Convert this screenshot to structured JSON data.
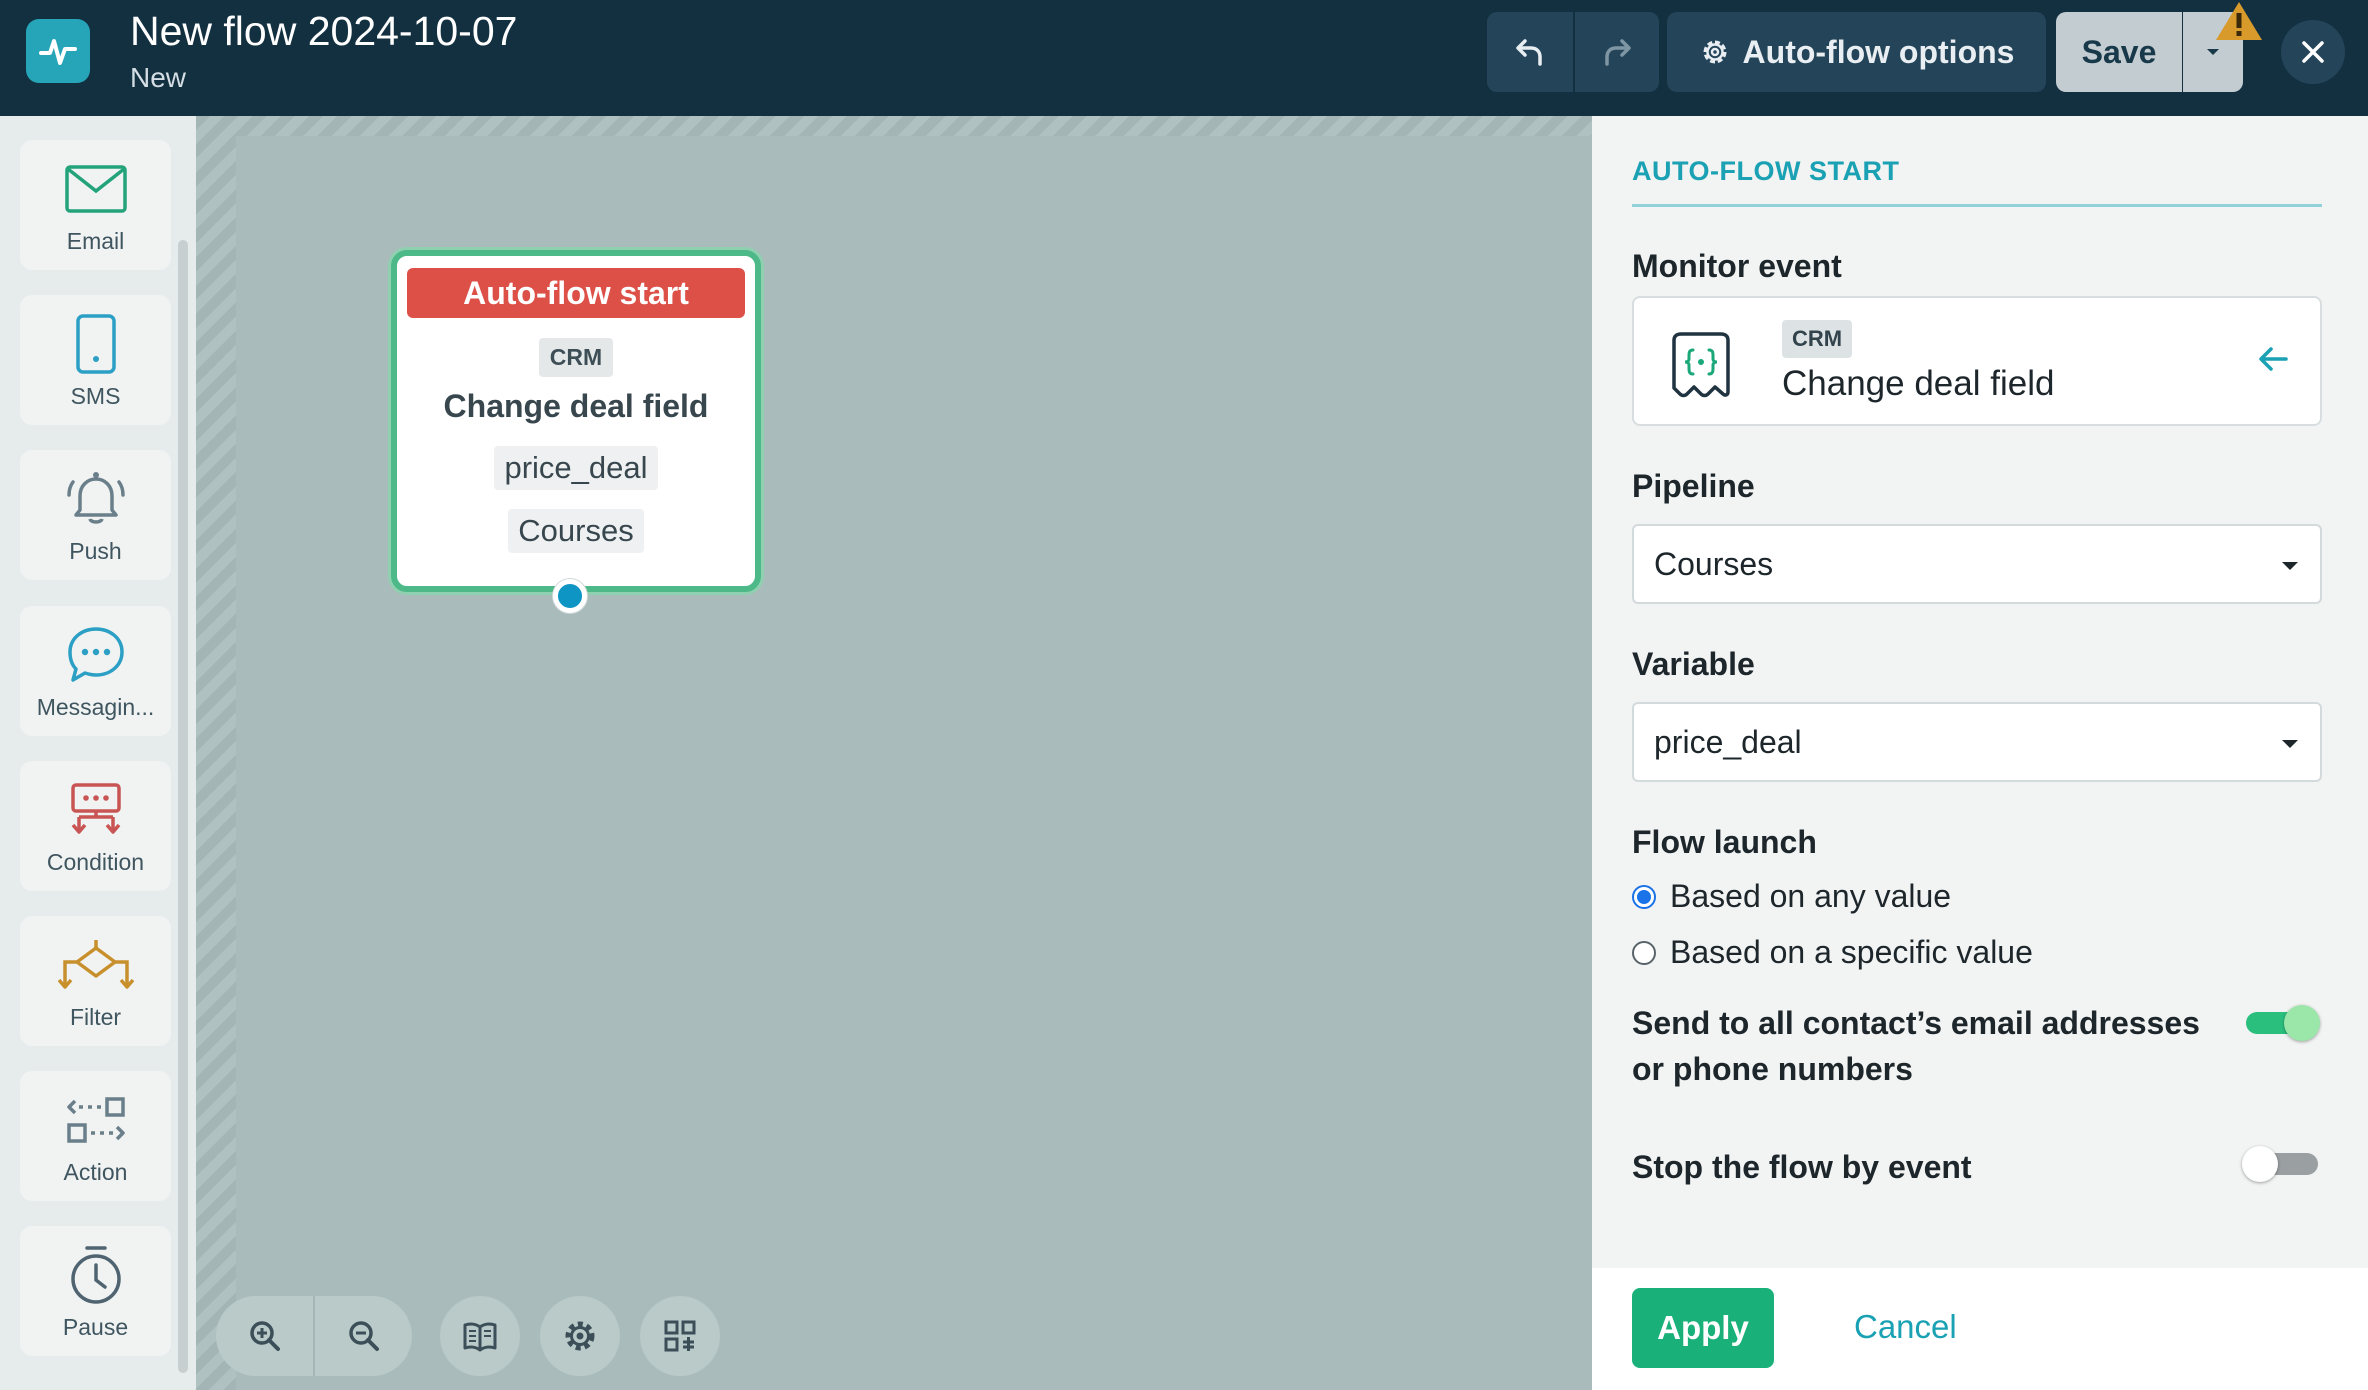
{
  "header": {
    "title": "New flow 2024-10-07",
    "status": "New",
    "options_label": "Auto-flow options",
    "save_label": "Save"
  },
  "toolbox": {
    "items": [
      {
        "label": "Email",
        "icon": "envelope-icon"
      },
      {
        "label": "SMS",
        "icon": "phone-icon"
      },
      {
        "label": "Push",
        "icon": "bell-icon"
      },
      {
        "label": "Messagin...",
        "icon": "chat-bubble-icon"
      },
      {
        "label": "Condition",
        "icon": "condition-icon"
      },
      {
        "label": "Filter",
        "icon": "filter-icon"
      },
      {
        "label": "Action",
        "icon": "action-icon"
      },
      {
        "label": "Pause",
        "icon": "timer-icon"
      }
    ]
  },
  "node": {
    "title": "Auto-flow start",
    "tag": "CRM",
    "event": "Change deal field",
    "variable": "price_deal",
    "pipeline": "Courses"
  },
  "panel": {
    "section_title": "AUTO-FLOW START",
    "monitor_label": "Monitor event",
    "monitor_tag": "CRM",
    "monitor_event": "Change deal field",
    "pipeline_label": "Pipeline",
    "pipeline_value": "Courses",
    "variable_label": "Variable",
    "variable_value": "price_deal",
    "launch_label": "Flow launch",
    "launch_options": [
      "Based on any value",
      "Based on a specific value"
    ],
    "launch_selected": "Based on any value",
    "send_all_label": "Send to all contact’s email addresses or phone numbers",
    "send_all_on": true,
    "stop_label": "Stop the flow by event",
    "stop_on": false,
    "apply_label": "Apply",
    "cancel_label": "Cancel"
  },
  "colors": {
    "header_bg": "#133040",
    "accent_teal": "#1aa1b3",
    "node_header": "#dc5048",
    "node_border": "#4db888",
    "apply_green": "#1ab07a",
    "radio_blue": "#1a73e8"
  }
}
